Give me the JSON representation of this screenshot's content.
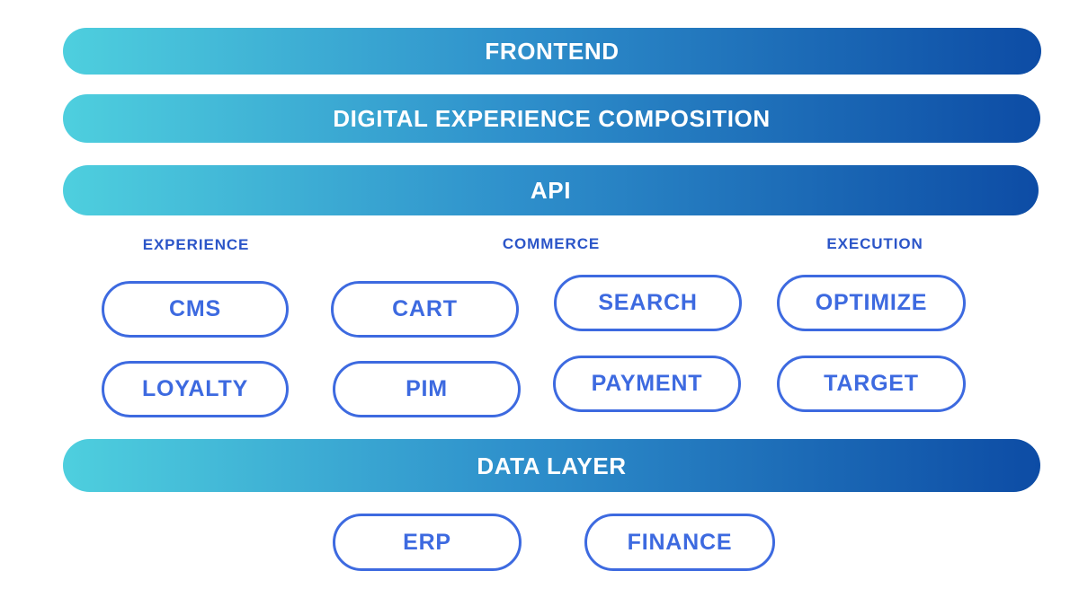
{
  "colors": {
    "gradient_start": "#4ECFDE",
    "gradient_mid": "#2E8FCB",
    "gradient_end": "#0D4CA5",
    "pill_blue": "#3D6AE0",
    "category_blue": "#2B55C8",
    "bar_text": "#FFFFFF",
    "background": "#FFFFFF"
  },
  "diagram": {
    "layers": [
      {
        "id": "frontend",
        "label": "FRONTEND"
      },
      {
        "id": "dxc",
        "label": "DIGITAL EXPERIENCE COMPOSITION"
      },
      {
        "id": "api",
        "label": "API"
      },
      {
        "id": "data_layer",
        "label": "DATA LAYER"
      }
    ],
    "categories": [
      {
        "id": "experience",
        "label": "EXPERIENCE"
      },
      {
        "id": "commerce",
        "label": "COMMERCE"
      },
      {
        "id": "execution",
        "label": "EXECUTION"
      }
    ],
    "capabilities": {
      "row1": [
        {
          "id": "cms",
          "label": "CMS",
          "category": "experience"
        },
        {
          "id": "cart",
          "label": "CART",
          "category": "commerce"
        },
        {
          "id": "search",
          "label": "SEARCH",
          "category": "commerce"
        },
        {
          "id": "optimize",
          "label": "OPTIMIZE",
          "category": "execution"
        }
      ],
      "row2": [
        {
          "id": "loyalty",
          "label": "LOYALTY",
          "category": "experience"
        },
        {
          "id": "pim",
          "label": "PIM",
          "category": "commerce"
        },
        {
          "id": "payment",
          "label": "PAYMENT",
          "category": "commerce"
        },
        {
          "id": "target",
          "label": "TARGET",
          "category": "execution"
        }
      ],
      "data_systems": [
        {
          "id": "erp",
          "label": "ERP"
        },
        {
          "id": "finance",
          "label": "FINANCE"
        }
      ]
    }
  }
}
